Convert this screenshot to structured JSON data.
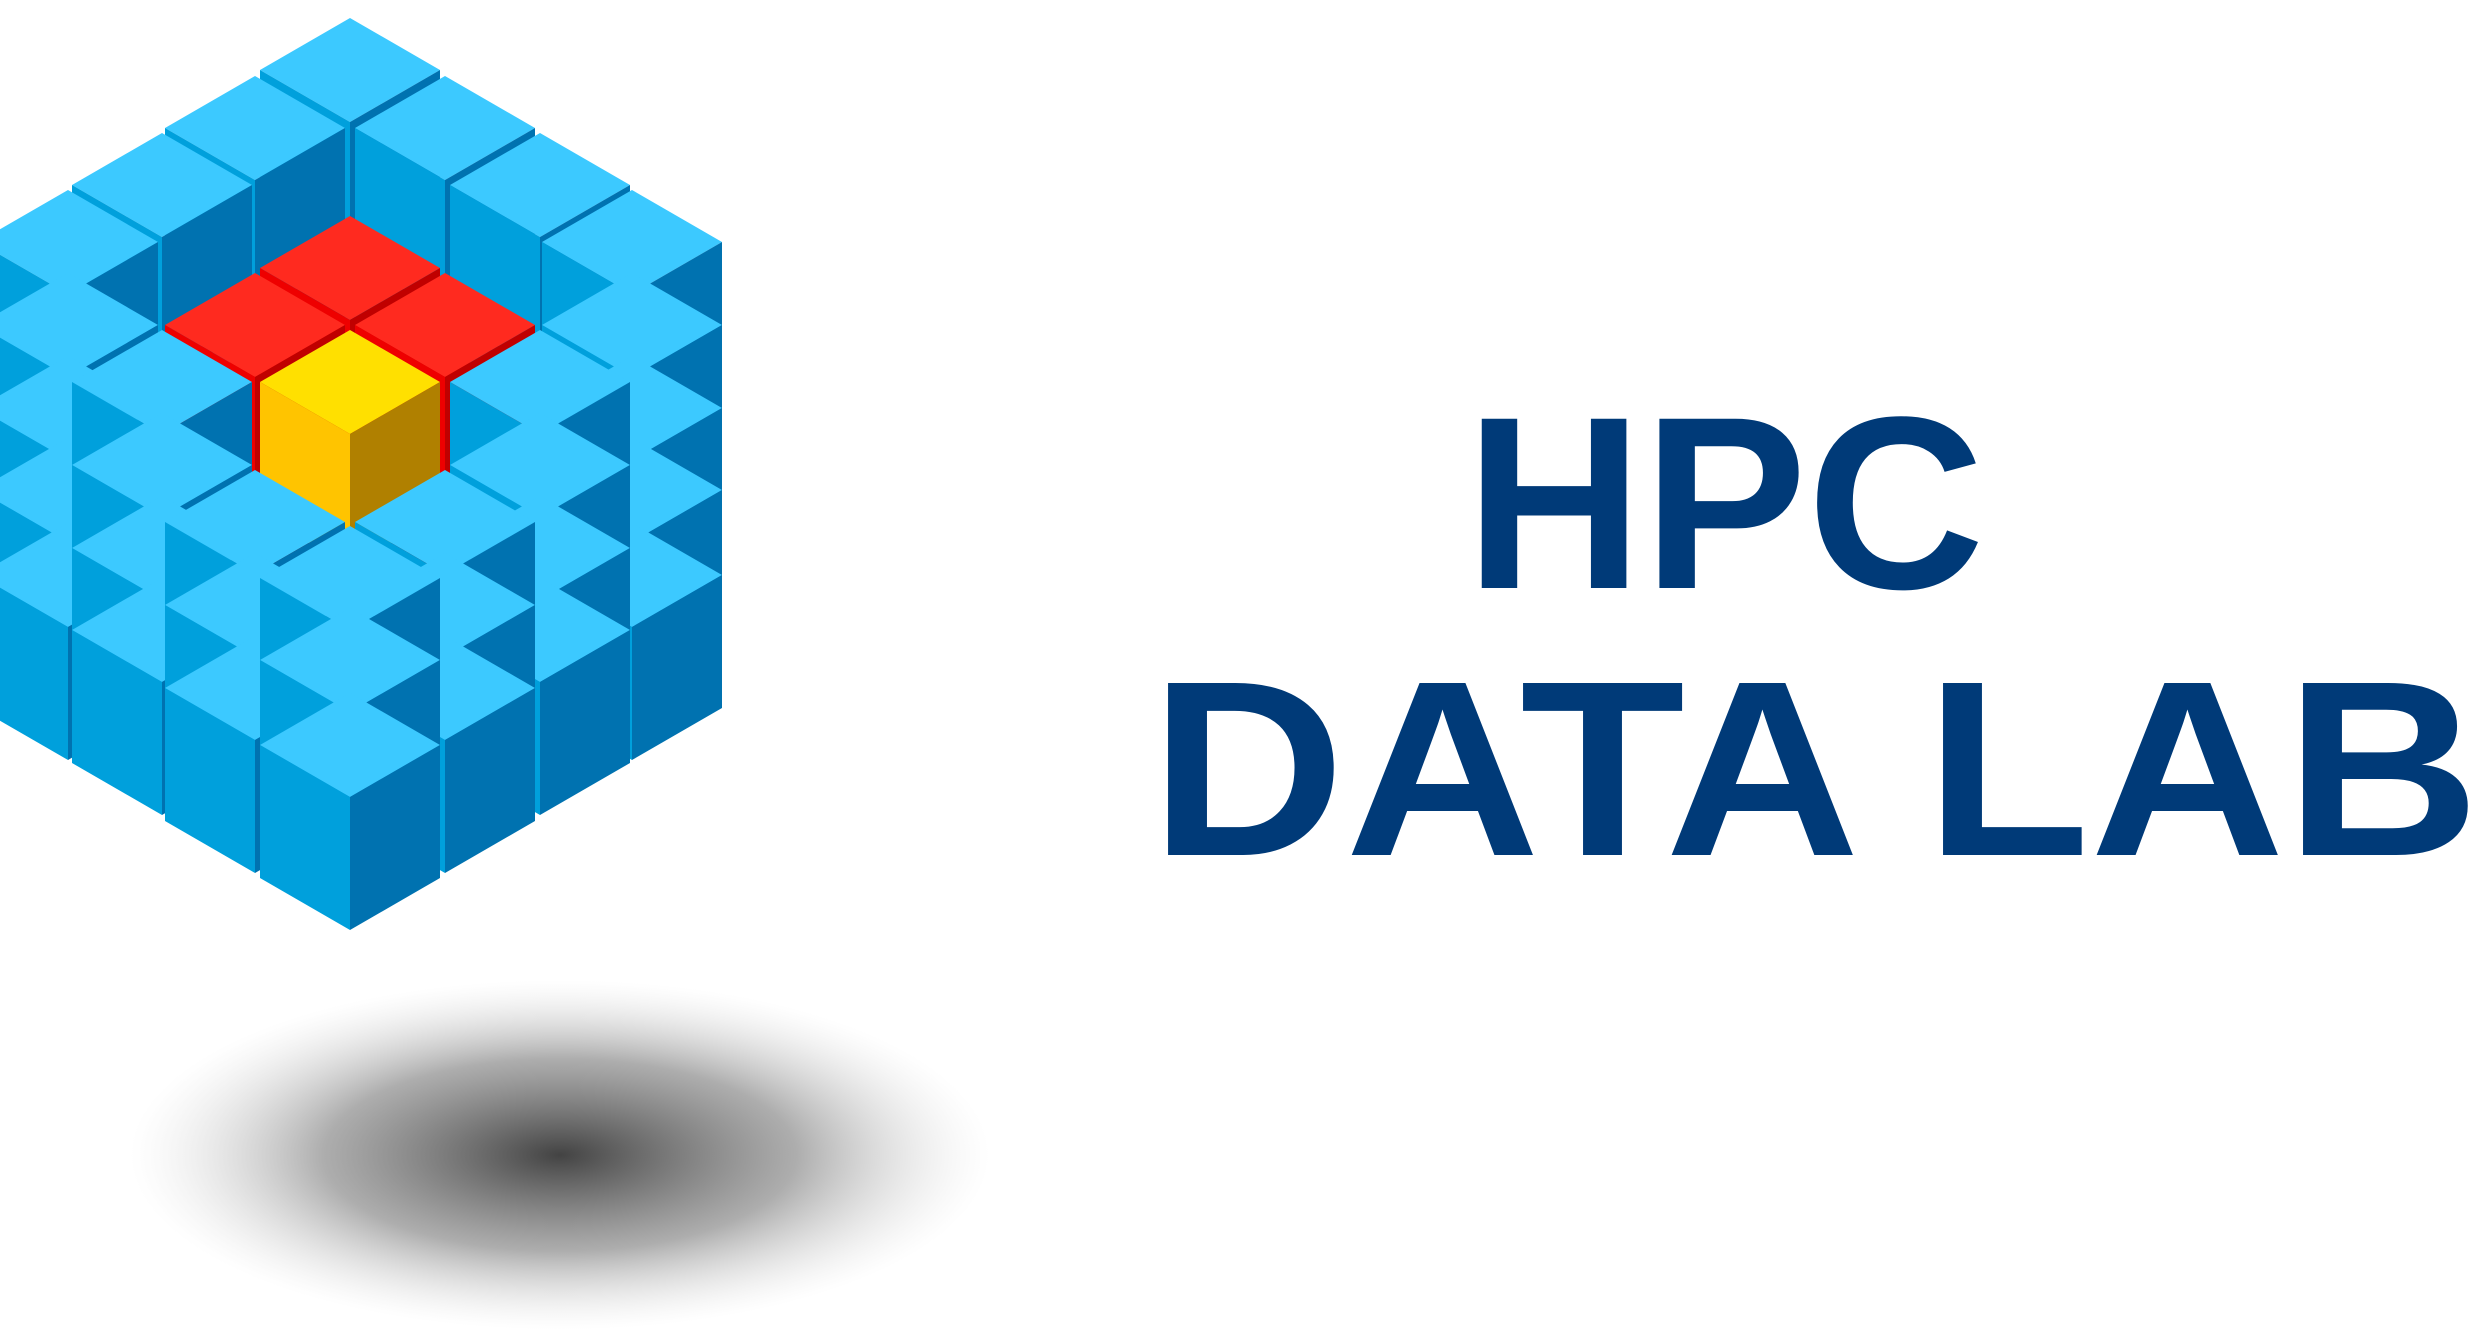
{
  "logo": {
    "line1": "HPC",
    "line2": "DATA LAB"
  },
  "colors": {
    "wordmark": "#003a78",
    "cube_top": "#3cc9ff",
    "cube_left": "#00a0dc",
    "cube_right": "#0072b0",
    "cube_top_dark": "#0b86c4",
    "cube_left_dark": "#0068a4",
    "cube_right_dark": "#003f74",
    "red_top": "#ff2a1f",
    "red_left": "#ee0000",
    "red_right": "#c00000",
    "red_left_dark": "#b80000",
    "red_right_dark": "#760000",
    "gold_top": "#ffe000",
    "gold_left": "#ffc400",
    "gold_right": "#b08000"
  }
}
